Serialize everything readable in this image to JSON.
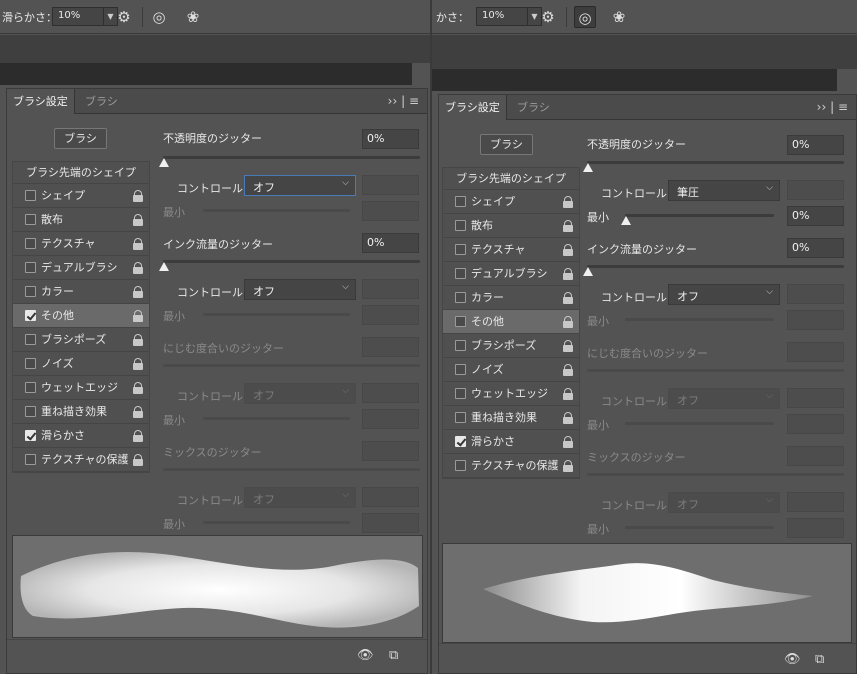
{
  "left": {
    "options": {
      "smoothing_label": "滑らかさ：",
      "smoothing_value": "10%"
    },
    "tabs": [
      "ブラシ設定",
      "ブラシ"
    ],
    "brush_button": "ブラシ",
    "tip_shape": "ブラシ先端のシェイプ",
    "items": [
      {
        "label": "シェイプ",
        "checked": false,
        "selected": false
      },
      {
        "label": "散布",
        "checked": false,
        "selected": false
      },
      {
        "label": "テクスチャ",
        "checked": false,
        "selected": false
      },
      {
        "label": "デュアルブラシ",
        "checked": false,
        "selected": false
      },
      {
        "label": "カラー",
        "checked": false,
        "selected": false
      },
      {
        "label": "その他",
        "checked": true,
        "selected": true
      },
      {
        "label": "ブラシポーズ",
        "checked": false,
        "selected": false
      },
      {
        "label": "ノイズ",
        "checked": false,
        "selected": false
      },
      {
        "label": "ウェットエッジ",
        "checked": false,
        "selected": false
      },
      {
        "label": "重ね描き効果",
        "checked": false,
        "selected": false
      },
      {
        "label": "滑らかさ",
        "checked": true,
        "selected": false
      },
      {
        "label": "テクスチャの保護",
        "checked": false,
        "selected": false
      }
    ],
    "opacity_jitter": "不透明度のジッター",
    "opacity_value": "0%",
    "control": "コントロール：",
    "control_off": "オフ",
    "min": "最小",
    "flow_jitter": "インク流量のジッター",
    "flow_value": "0%",
    "wet_jitter": "にじむ度合いのジッター",
    "mix_jitter": "ミックスのジッター",
    "opacity_knob_pct": 0,
    "flow_knob_pct": 0
  },
  "right": {
    "options": {
      "smoothing_label": "かさ：",
      "smoothing_value": "10%"
    },
    "tabs": [
      "ブラシ設定",
      "ブラシ"
    ],
    "brush_button": "ブラシ",
    "tip_shape": "ブラシ先端のシェイプ",
    "items": [
      {
        "label": "シェイプ",
        "checked": false,
        "selected": false
      },
      {
        "label": "散布",
        "checked": false,
        "selected": false
      },
      {
        "label": "テクスチャ",
        "checked": false,
        "selected": false
      },
      {
        "label": "デュアルブラシ",
        "checked": false,
        "selected": false
      },
      {
        "label": "カラー",
        "checked": false,
        "selected": false
      },
      {
        "label": "その他",
        "checked": false,
        "selected": true
      },
      {
        "label": "ブラシポーズ",
        "checked": false,
        "selected": false
      },
      {
        "label": "ノイズ",
        "checked": false,
        "selected": false
      },
      {
        "label": "ウェットエッジ",
        "checked": false,
        "selected": false
      },
      {
        "label": "重ね描き効果",
        "checked": false,
        "selected": false
      },
      {
        "label": "滑らかさ",
        "checked": true,
        "selected": false
      },
      {
        "label": "テクスチャの保護",
        "checked": false,
        "selected": false
      }
    ],
    "opacity_jitter": "不透明度のジッター",
    "opacity_value": "0%",
    "control": "コントロール：",
    "control_pressure": "筆圧",
    "control_off": "オフ",
    "min": "最小",
    "min_value": "0%",
    "flow_jitter": "インク流量のジッター",
    "flow_value": "0%",
    "wet_jitter": "にじむ度合いのジッター",
    "mix_jitter": "ミックスのジッター"
  },
  "icons": [
    "gear-icon",
    "pressure-icon",
    "butterfly-icon",
    "toggle-preview-icon",
    "new-preset-icon"
  ],
  "colors": {
    "panel": "#535353",
    "selected_row": "#6a6a6a",
    "accent": "#4a7ab8"
  }
}
